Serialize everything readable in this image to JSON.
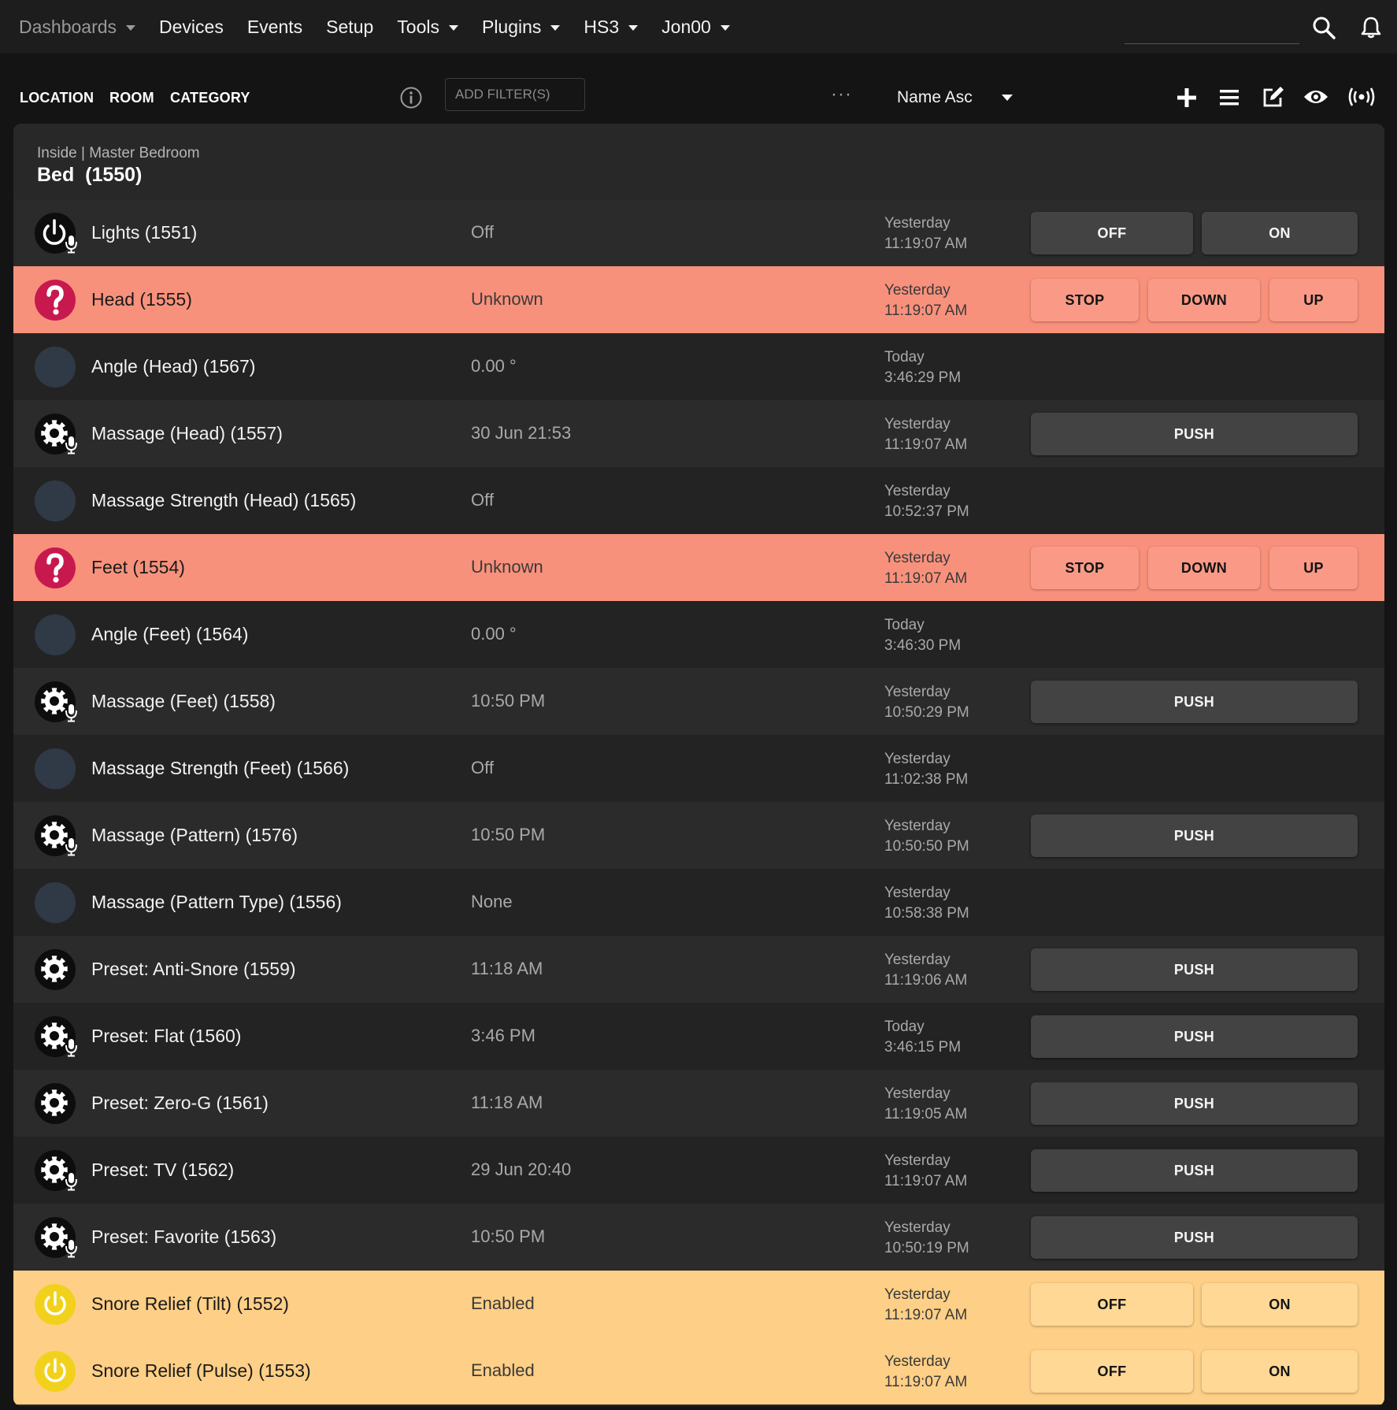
{
  "nav": {
    "items": [
      {
        "label": "Dashboards",
        "caret": true,
        "dim": true
      },
      {
        "label": "Devices",
        "caret": false
      },
      {
        "label": "Events",
        "caret": false
      },
      {
        "label": "Setup",
        "caret": false
      },
      {
        "label": "Tools",
        "caret": true
      },
      {
        "label": "Plugins",
        "caret": true
      },
      {
        "label": "HS3",
        "caret": true
      },
      {
        "label": "Jon00",
        "caret": true
      }
    ],
    "icons": [
      "search-icon",
      "bell-icon"
    ]
  },
  "toolbar": {
    "location": "LOCATION",
    "room": "ROOM",
    "category": "CATEGORY",
    "filter_placeholder": "ADD FILTER(S)",
    "more": "···",
    "sort": "Name Asc",
    "icons": [
      "info-icon",
      "more-icon",
      "caret-down-icon",
      "plus-icon",
      "list-icon",
      "edit-icon",
      "eye-icon",
      "broadcast-icon"
    ]
  },
  "group": {
    "location": "Inside | Master Bedroom",
    "title": "Bed  (1550)"
  },
  "colors": {
    "unknown_row": "#f8917c",
    "enabled_row": "#fecf86",
    "question_icon": "#c8194f",
    "power_yellow": "#f2d11c"
  },
  "devices": [
    {
      "name": "Lights (1551)",
      "status": "Off",
      "t1": "Yesterday",
      "t2": "11:19:07 AM",
      "icon": "power-mic-icon",
      "state": "dark",
      "buttons": [
        "OFF",
        "ON"
      ]
    },
    {
      "name": "Head (1555)",
      "status": "Unknown",
      "t1": "Yesterday",
      "t2": "11:19:07 AM",
      "icon": "question-icon",
      "state": "unknown",
      "buttons": [
        "STOP",
        "DOWN",
        "UP"
      ]
    },
    {
      "name": "Angle (Head) (1567)",
      "status": "0.00 °",
      "t1": "Today",
      "t2": "3:46:29 PM",
      "icon": "blank-circle-icon",
      "state": "alt",
      "buttons": []
    },
    {
      "name": "Massage (Head) (1557)",
      "status": "30 Jun 21:53",
      "t1": "Yesterday",
      "t2": "11:19:07 AM",
      "icon": "gear-mic-icon",
      "state": "dark",
      "buttons": [
        "PUSH"
      ]
    },
    {
      "name": "Massage Strength (Head) (1565)",
      "status": "Off",
      "t1": "Yesterday",
      "t2": "10:52:37 PM",
      "icon": "blank-circle-icon",
      "state": "alt",
      "buttons": []
    },
    {
      "name": "Feet (1554)",
      "status": "Unknown",
      "t1": "Yesterday",
      "t2": "11:19:07 AM",
      "icon": "question-icon",
      "state": "unknown",
      "buttons": [
        "STOP",
        "DOWN",
        "UP"
      ]
    },
    {
      "name": "Angle (Feet) (1564)",
      "status": "0.00 °",
      "t1": "Today",
      "t2": "3:46:30 PM",
      "icon": "blank-circle-icon",
      "state": "alt",
      "buttons": []
    },
    {
      "name": "Massage (Feet) (1558)",
      "status": "10:50 PM",
      "t1": "Yesterday",
      "t2": "10:50:29 PM",
      "icon": "gear-mic-icon",
      "state": "dark",
      "buttons": [
        "PUSH"
      ]
    },
    {
      "name": "Massage Strength (Feet) (1566)",
      "status": "Off",
      "t1": "Yesterday",
      "t2": "11:02:38 PM",
      "icon": "blank-circle-icon",
      "state": "alt",
      "buttons": []
    },
    {
      "name": "Massage (Pattern) (1576)",
      "status": "10:50 PM",
      "t1": "Yesterday",
      "t2": "10:50:50 PM",
      "icon": "gear-mic-icon",
      "state": "dark",
      "buttons": [
        "PUSH"
      ]
    },
    {
      "name": "Massage (Pattern Type) (1556)",
      "status": "None",
      "t1": "Yesterday",
      "t2": "10:58:38 PM",
      "icon": "blank-circle-icon",
      "state": "alt",
      "buttons": []
    },
    {
      "name": "Preset: Anti-Snore (1559)",
      "status": "11:18 AM",
      "t1": "Yesterday",
      "t2": "11:19:06 AM",
      "icon": "gear-icon",
      "state": "dark",
      "buttons": [
        "PUSH"
      ]
    },
    {
      "name": "Preset: Flat (1560)",
      "status": "3:46 PM",
      "t1": "Today",
      "t2": "3:46:15 PM",
      "icon": "gear-mic-icon",
      "state": "alt",
      "buttons": [
        "PUSH"
      ]
    },
    {
      "name": "Preset: Zero-G (1561)",
      "status": "11:18 AM",
      "t1": "Yesterday",
      "t2": "11:19:05 AM",
      "icon": "gear-icon",
      "state": "dark",
      "buttons": [
        "PUSH"
      ]
    },
    {
      "name": "Preset: TV (1562)",
      "status": "29 Jun 20:40",
      "t1": "Yesterday",
      "t2": "11:19:07 AM",
      "icon": "gear-mic-icon",
      "state": "alt",
      "buttons": [
        "PUSH"
      ]
    },
    {
      "name": "Preset: Favorite (1563)",
      "status": "10:50 PM",
      "t1": "Yesterday",
      "t2": "10:50:19 PM",
      "icon": "gear-mic-icon",
      "state": "dark",
      "buttons": [
        "PUSH"
      ]
    },
    {
      "name": "Snore Relief (Tilt) (1552)",
      "status": "Enabled",
      "t1": "Yesterday",
      "t2": "11:19:07 AM",
      "icon": "power-yellow-icon",
      "state": "enabled",
      "buttons": [
        "OFF",
        "ON"
      ]
    },
    {
      "name": "Snore Relief (Pulse) (1553)",
      "status": "Enabled",
      "t1": "Yesterday",
      "t2": "11:19:07 AM",
      "icon": "power-yellow-icon",
      "state": "enabled",
      "buttons": [
        "OFF",
        "ON"
      ]
    }
  ]
}
